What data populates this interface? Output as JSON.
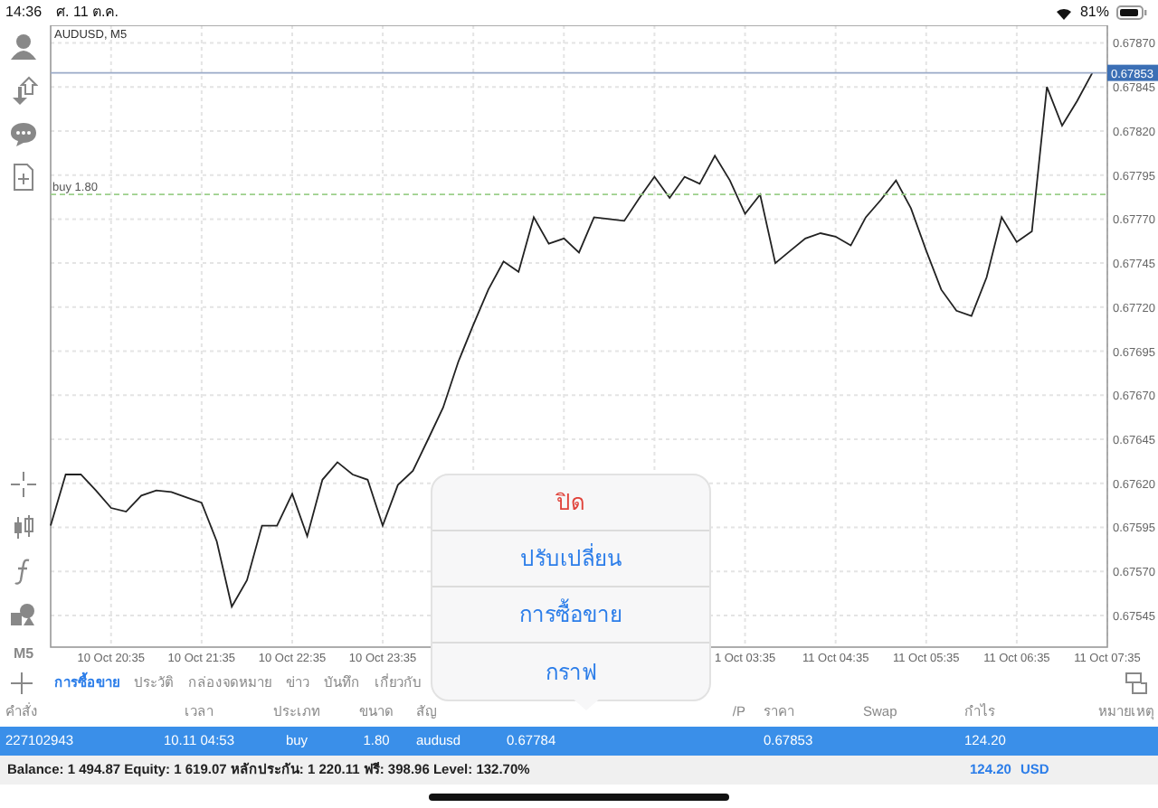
{
  "status_bar": {
    "time": "14:36",
    "date": "ศ. 11 ต.ค.",
    "battery": "81%"
  },
  "toolbar": {
    "timeframe": "M5"
  },
  "chart": {
    "price_tag": "0.67853",
    "order_label": "buy 1.80",
    "chart_data": {
      "type": "line",
      "title": "AUDUSD, M5",
      "categories": [
        null,
        null,
        null,
        null,
        "10 Oct 20:35",
        null,
        null,
        null,
        null,
        null,
        "10 Oct 21:35",
        null,
        null,
        null,
        null,
        null,
        "10 Oct 22:35",
        null,
        null,
        null,
        null,
        null,
        "10 Oct 23:35",
        null,
        null,
        null,
        null,
        null,
        null,
        null,
        null,
        null,
        null,
        null,
        null,
        null,
        null,
        null,
        null,
        null,
        null,
        null,
        null,
        null,
        null,
        null,
        "1 Oct 03:35",
        null,
        null,
        null,
        null,
        null,
        "11 Oct 04:35",
        null,
        null,
        null,
        null,
        null,
        "11 Oct 05:35",
        null,
        null,
        null,
        null,
        null,
        "11 Oct 06:35",
        null,
        null,
        null,
        null,
        null,
        "11 Oct 07:35"
      ],
      "values": [
        0.67596,
        0.67625,
        0.67625,
        0.67616,
        0.67606,
        0.67604,
        0.67613,
        0.67616,
        0.67615,
        0.67612,
        0.67609,
        0.67587,
        0.6755,
        0.67565,
        0.67596,
        0.67596,
        0.67614,
        0.6759,
        0.67622,
        0.67632,
        0.67625,
        0.67622,
        0.67596,
        0.67619,
        0.67627,
        0.67645,
        0.67663,
        0.67689,
        0.6771,
        0.6773,
        0.67746,
        0.6774,
        0.67771,
        0.67756,
        0.67759,
        0.67751,
        0.67771,
        0.6777,
        0.67769,
        0.67782,
        0.67794,
        0.67782,
        0.67794,
        0.6779,
        0.67806,
        0.67792,
        0.67773,
        0.67784,
        0.67745,
        0.67752,
        0.67759,
        0.67762,
        0.6776,
        0.67755,
        0.67771,
        0.67781,
        0.67792,
        0.67776,
        0.67752,
        0.6773,
        0.67718,
        0.67715,
        0.67737,
        0.67771,
        0.67757,
        0.67763,
        0.67845,
        0.67823,
        0.67837,
        0.67853,
        null
      ],
      "ylim": [
        0.67527,
        0.6788
      ],
      "grid": true,
      "yticks": [
        {
          "value": 0.6787,
          "label": "0.67870"
        },
        0.67845,
        {
          "value": 0.6782,
          "label": "0.67820"
        },
        0.67795,
        {
          "value": 0.6777,
          "label": "0.67770"
        },
        0.67745,
        {
          "value": 0.6772,
          "label": "0.67720"
        },
        0.67695,
        {
          "value": 0.6767,
          "label": "0.67670"
        },
        0.67645,
        {
          "value": 0.6762,
          "label": "0.67620"
        },
        0.67595,
        {
          "value": 0.6757,
          "label": "0.67570"
        },
        0.67545
      ]
    }
  },
  "tabs": [
    {
      "label": "การซื้อขาย",
      "selected": true
    },
    {
      "label": "ประวัติ",
      "selected": false
    },
    {
      "label": "กล่องจดหมาย",
      "selected": false
    },
    {
      "label": "ข่าว",
      "selected": false
    },
    {
      "label": "บันทึก",
      "selected": false
    },
    {
      "label": "เกี่ยวกับ",
      "selected": false
    }
  ],
  "table": {
    "columns": {
      "order": "คำสั่ง",
      "time": "เวลา",
      "type": "ประเภท",
      "volume": "ขนาด",
      "symbol": "สัญ",
      "tp": "/P",
      "price": "ราคา",
      "swap": "Swap",
      "profit": "กำไร",
      "comment": "หมายเหตุ"
    },
    "rows": [
      {
        "order": "227102943",
        "time": "10.11 04:53",
        "type": "buy",
        "volume": "1.80",
        "symbol": "audusd",
        "open_price": "0.67784",
        "price": "0.67853",
        "profit": "124.20",
        "selected": true
      }
    ]
  },
  "summary": {
    "text": "Balance: 1 494.87 Equity: 1 619.07 หลักประกัน: 1 220.11 ฟรี: 398.96 Level: 132.70%",
    "profit": "124.20",
    "currency": "USD"
  },
  "menu": {
    "items": [
      {
        "label": "ปิด",
        "kind": "destructive"
      },
      {
        "label": "ปรับเปลี่ยน",
        "kind": "action"
      },
      {
        "label": "การซื้อขาย",
        "kind": "action"
      },
      {
        "label": "กราฟ",
        "kind": "action"
      }
    ]
  }
}
